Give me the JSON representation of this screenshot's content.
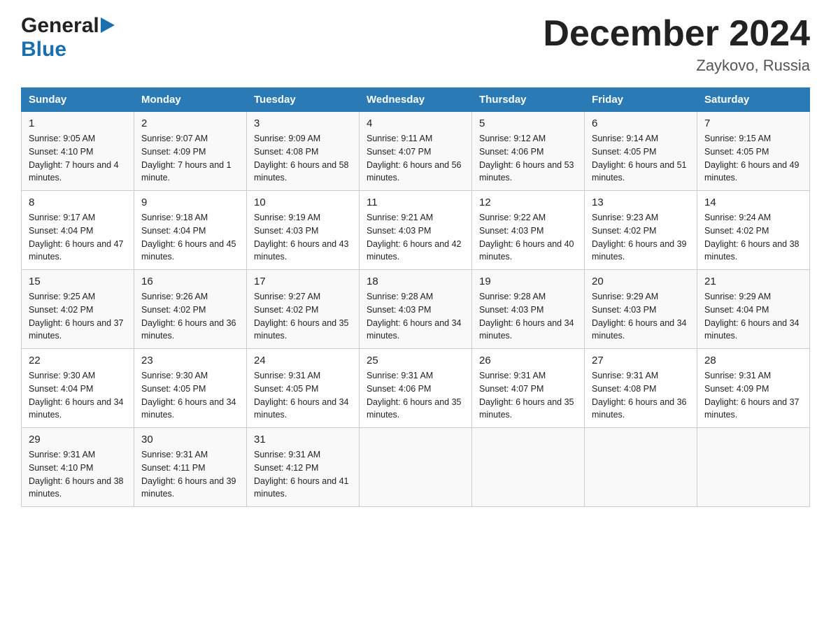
{
  "header": {
    "logo_general": "General",
    "logo_blue": "Blue",
    "month_title": "December 2024",
    "location": "Zaykovo, Russia"
  },
  "days_of_week": [
    "Sunday",
    "Monday",
    "Tuesday",
    "Wednesday",
    "Thursday",
    "Friday",
    "Saturday"
  ],
  "weeks": [
    [
      {
        "day": "1",
        "sunrise": "9:05 AM",
        "sunset": "4:10 PM",
        "daylight": "7 hours and 4 minutes."
      },
      {
        "day": "2",
        "sunrise": "9:07 AM",
        "sunset": "4:09 PM",
        "daylight": "7 hours and 1 minute."
      },
      {
        "day": "3",
        "sunrise": "9:09 AM",
        "sunset": "4:08 PM",
        "daylight": "6 hours and 58 minutes."
      },
      {
        "day": "4",
        "sunrise": "9:11 AM",
        "sunset": "4:07 PM",
        "daylight": "6 hours and 56 minutes."
      },
      {
        "day": "5",
        "sunrise": "9:12 AM",
        "sunset": "4:06 PM",
        "daylight": "6 hours and 53 minutes."
      },
      {
        "day": "6",
        "sunrise": "9:14 AM",
        "sunset": "4:05 PM",
        "daylight": "6 hours and 51 minutes."
      },
      {
        "day": "7",
        "sunrise": "9:15 AM",
        "sunset": "4:05 PM",
        "daylight": "6 hours and 49 minutes."
      }
    ],
    [
      {
        "day": "8",
        "sunrise": "9:17 AM",
        "sunset": "4:04 PM",
        "daylight": "6 hours and 47 minutes."
      },
      {
        "day": "9",
        "sunrise": "9:18 AM",
        "sunset": "4:04 PM",
        "daylight": "6 hours and 45 minutes."
      },
      {
        "day": "10",
        "sunrise": "9:19 AM",
        "sunset": "4:03 PM",
        "daylight": "6 hours and 43 minutes."
      },
      {
        "day": "11",
        "sunrise": "9:21 AM",
        "sunset": "4:03 PM",
        "daylight": "6 hours and 42 minutes."
      },
      {
        "day": "12",
        "sunrise": "9:22 AM",
        "sunset": "4:03 PM",
        "daylight": "6 hours and 40 minutes."
      },
      {
        "day": "13",
        "sunrise": "9:23 AM",
        "sunset": "4:02 PM",
        "daylight": "6 hours and 39 minutes."
      },
      {
        "day": "14",
        "sunrise": "9:24 AM",
        "sunset": "4:02 PM",
        "daylight": "6 hours and 38 minutes."
      }
    ],
    [
      {
        "day": "15",
        "sunrise": "9:25 AM",
        "sunset": "4:02 PM",
        "daylight": "6 hours and 37 minutes."
      },
      {
        "day": "16",
        "sunrise": "9:26 AM",
        "sunset": "4:02 PM",
        "daylight": "6 hours and 36 minutes."
      },
      {
        "day": "17",
        "sunrise": "9:27 AM",
        "sunset": "4:02 PM",
        "daylight": "6 hours and 35 minutes."
      },
      {
        "day": "18",
        "sunrise": "9:28 AM",
        "sunset": "4:03 PM",
        "daylight": "6 hours and 34 minutes."
      },
      {
        "day": "19",
        "sunrise": "9:28 AM",
        "sunset": "4:03 PM",
        "daylight": "6 hours and 34 minutes."
      },
      {
        "day": "20",
        "sunrise": "9:29 AM",
        "sunset": "4:03 PM",
        "daylight": "6 hours and 34 minutes."
      },
      {
        "day": "21",
        "sunrise": "9:29 AM",
        "sunset": "4:04 PM",
        "daylight": "6 hours and 34 minutes."
      }
    ],
    [
      {
        "day": "22",
        "sunrise": "9:30 AM",
        "sunset": "4:04 PM",
        "daylight": "6 hours and 34 minutes."
      },
      {
        "day": "23",
        "sunrise": "9:30 AM",
        "sunset": "4:05 PM",
        "daylight": "6 hours and 34 minutes."
      },
      {
        "day": "24",
        "sunrise": "9:31 AM",
        "sunset": "4:05 PM",
        "daylight": "6 hours and 34 minutes."
      },
      {
        "day": "25",
        "sunrise": "9:31 AM",
        "sunset": "4:06 PM",
        "daylight": "6 hours and 35 minutes."
      },
      {
        "day": "26",
        "sunrise": "9:31 AM",
        "sunset": "4:07 PM",
        "daylight": "6 hours and 35 minutes."
      },
      {
        "day": "27",
        "sunrise": "9:31 AM",
        "sunset": "4:08 PM",
        "daylight": "6 hours and 36 minutes."
      },
      {
        "day": "28",
        "sunrise": "9:31 AM",
        "sunset": "4:09 PM",
        "daylight": "6 hours and 37 minutes."
      }
    ],
    [
      {
        "day": "29",
        "sunrise": "9:31 AM",
        "sunset": "4:10 PM",
        "daylight": "6 hours and 38 minutes."
      },
      {
        "day": "30",
        "sunrise": "9:31 AM",
        "sunset": "4:11 PM",
        "daylight": "6 hours and 39 minutes."
      },
      {
        "day": "31",
        "sunrise": "9:31 AM",
        "sunset": "4:12 PM",
        "daylight": "6 hours and 41 minutes."
      },
      null,
      null,
      null,
      null
    ]
  ]
}
